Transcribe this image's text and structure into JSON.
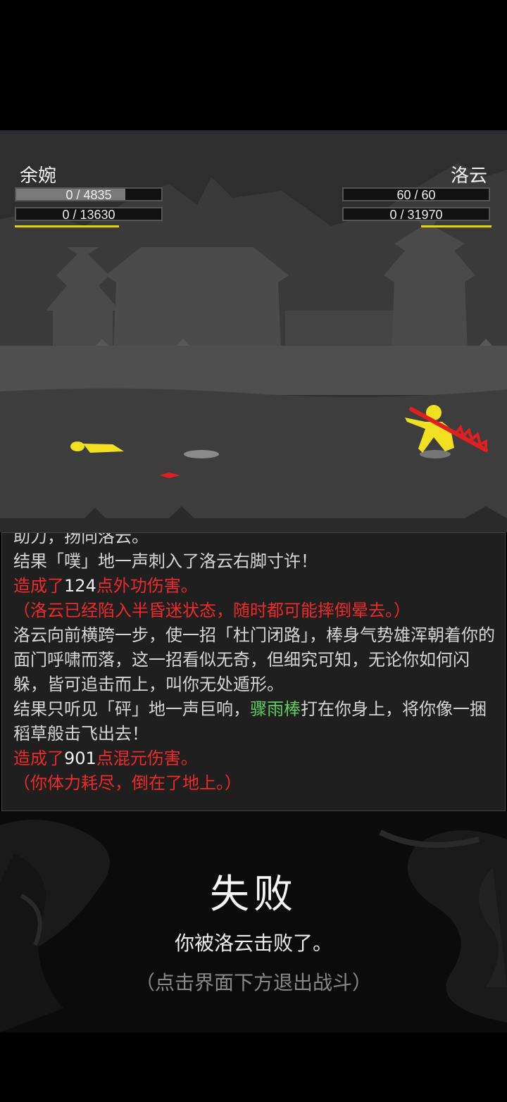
{
  "player": {
    "name": "余婉",
    "hp_text": "0 / 4835",
    "mp_text": "0 / 13630",
    "hp_bar_level": 0.75
  },
  "enemy": {
    "name": "洛云",
    "hp_text": "60 / 60",
    "mp_text": "0 / 31970"
  },
  "log": {
    "line0": "助力，扬向洛云。",
    "line1": "结果「噗」地一声刺入了洛云右脚寸许！",
    "dmg1_pre": "造成了",
    "dmg1_num": "124",
    "dmg1_post": "点外功伤害。",
    "status1": "（洛云已经陷入半昏迷状态，随时都可能摔倒晕去。）",
    "line3": "洛云向前横跨一步，使一招「杜门闭路」，棒身气势雄浑朝着你的面门呼啸而落，这一招看似无奇，但细究可知，无论你如何闪躲，皆可追击而上，叫你无处遁形。",
    "line4_pre": "结果只听见「砰」地一声巨响，",
    "weapon": "骤雨棒",
    "line4_post": "打在你身上，将你像一捆稻草般击飞出去！",
    "dmg2_pre": "造成了",
    "dmg2_num": "901",
    "dmg2_post": "点混元伤害。",
    "status2": "（你体力耗尽，倒在了地上。）"
  },
  "result": {
    "title": "失败",
    "message": "你被洛云击败了。",
    "hint": "（点击界面下方退出战斗）"
  },
  "colors": {
    "damage": "#ee2a2a",
    "weapon": "#5ecf5e",
    "character": "#f0e020",
    "blade": "#e02020"
  }
}
